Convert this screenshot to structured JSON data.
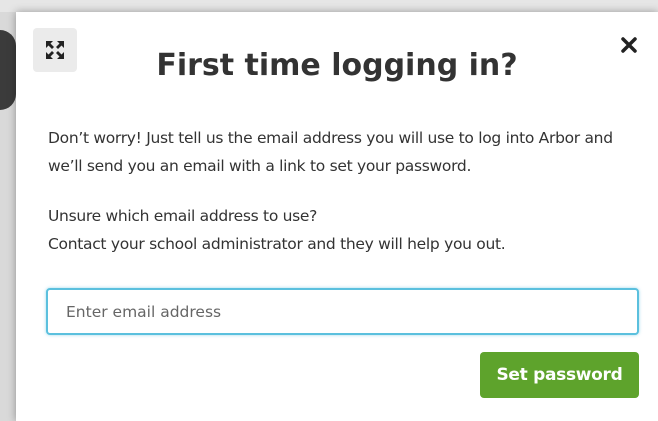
{
  "modal": {
    "title": "First time logging in?",
    "paragraph1": "Don’t worry! Just tell us the email address you will use to log into Arbor and we’ll send you an email with a link to set your password.",
    "paragraph2_line1": "Unsure which email address to use?",
    "paragraph2_line2": "Contact your school administrator and they will help you out.",
    "email_placeholder": "Enter email address",
    "email_value": "",
    "submit_label": "Set password",
    "expand_icon": "expand-icon",
    "close_icon": "close-icon"
  },
  "colors": {
    "accent_green": "#5ea32c",
    "input_focus_border": "#5bc0de",
    "text": "#333333"
  }
}
